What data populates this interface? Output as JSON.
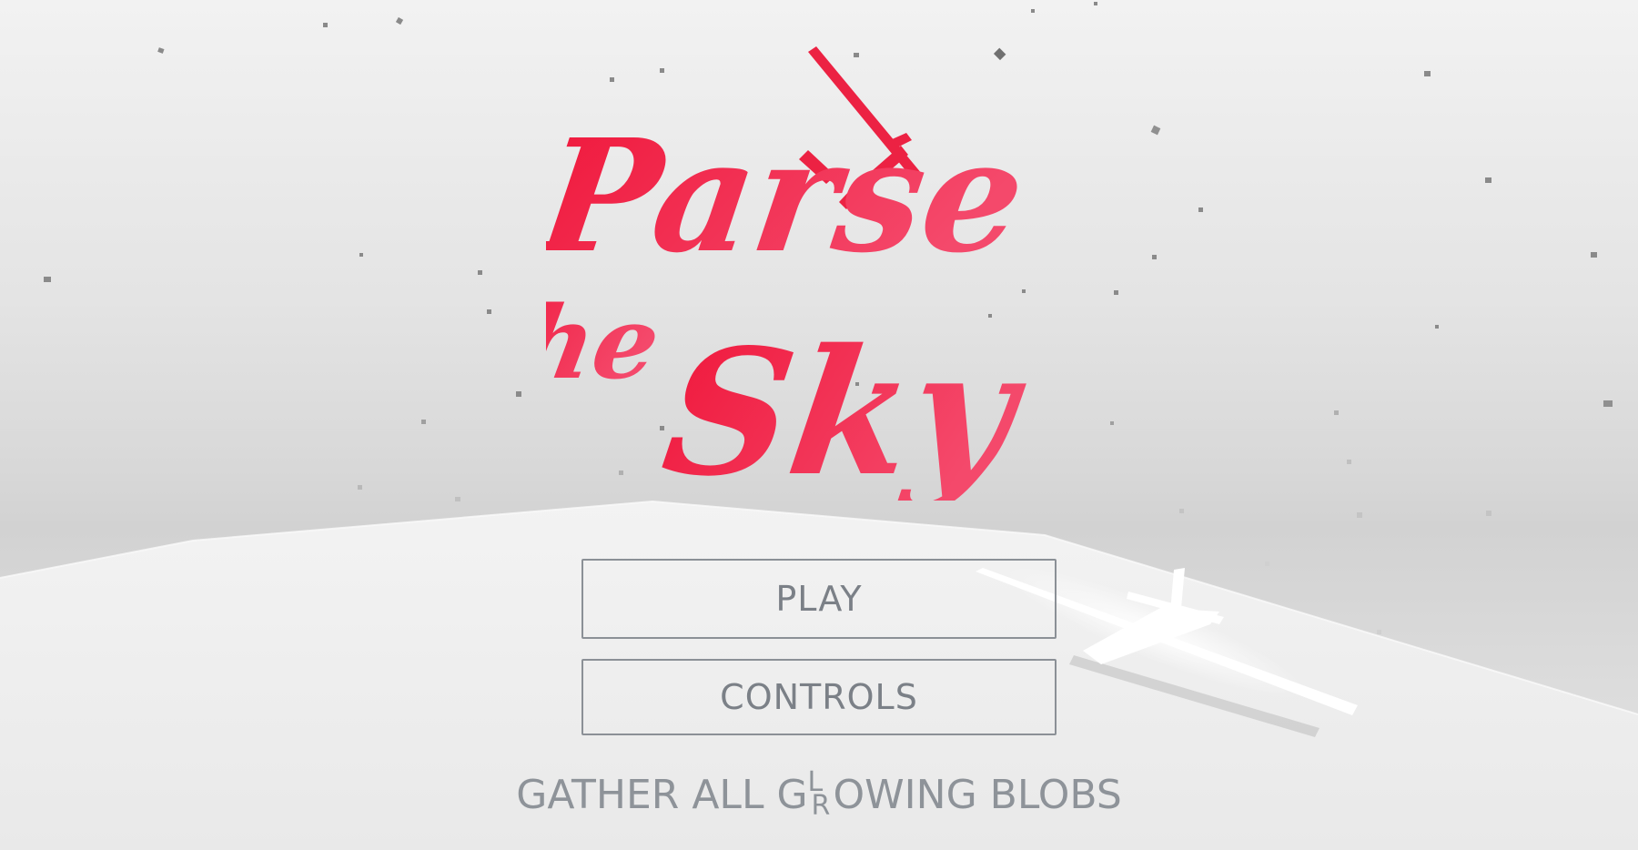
{
  "game": {
    "title": "Parse the Sky",
    "title_color_start": "#f0183c",
    "title_color_end": "#f44a6c"
  },
  "menu": {
    "play_label": "PLAY",
    "controls_label": "CONTROLS"
  },
  "tagline": {
    "prefix": "GATHER ALL G",
    "glitch_top": "L",
    "glitch_bottom": "R",
    "suffix": "OWING BLOBS"
  },
  "icons": {
    "logo_plane": "airplane-icon",
    "scene_plane": "glider-plane"
  }
}
